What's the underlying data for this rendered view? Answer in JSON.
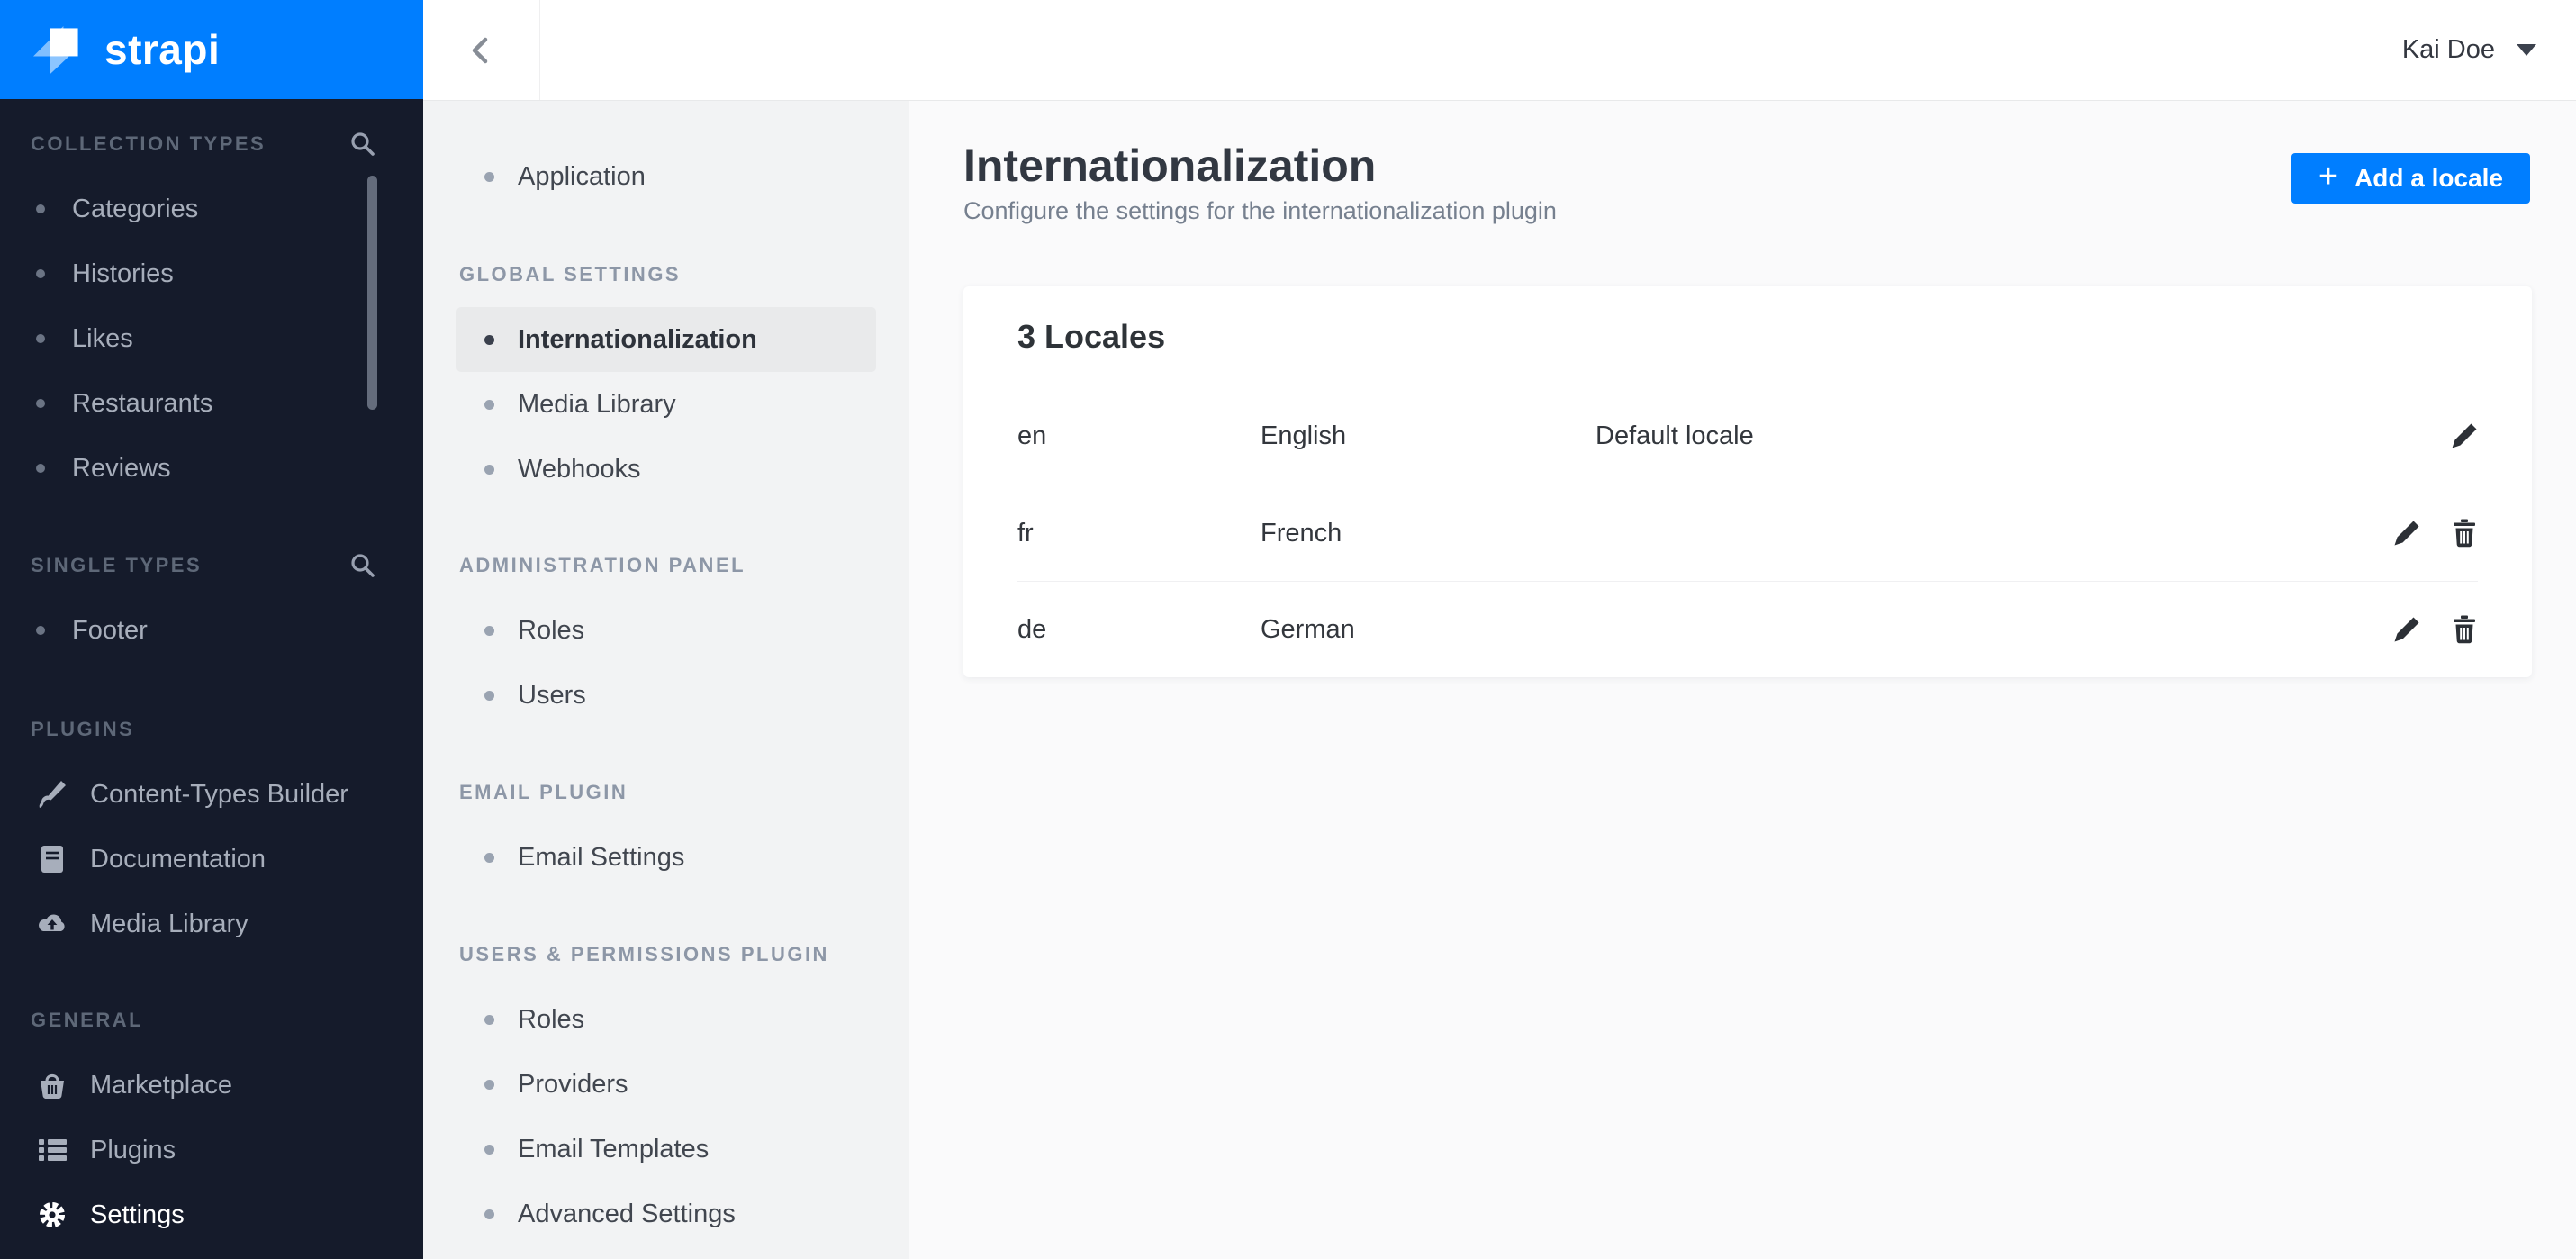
{
  "colors": {
    "accent": "#007eff",
    "sidebar_bg": "#151b2b",
    "selected_item_bg": "#e9eaeb",
    "content_bg": "#fafafb",
    "secondary_nav_bg": "#f2f3f4"
  },
  "logo": {
    "text": "strapi"
  },
  "topbar": {
    "user_name": "Kai Doe"
  },
  "icons": {
    "search": "magnifier",
    "content_types_builder": "paintbrush",
    "documentation": "book",
    "media_library": "cloud-upload",
    "marketplace": "basket",
    "plugins": "list",
    "settings": "gear",
    "back": "chevron-left",
    "user_caret": "caret-down",
    "add": "plus",
    "edit": "pencil",
    "delete": "trash"
  },
  "sidebar": {
    "sections": [
      {
        "label": "COLLECTION TYPES",
        "has_search": true,
        "items": [
          {
            "label": "Categories"
          },
          {
            "label": "Histories"
          },
          {
            "label": "Likes"
          },
          {
            "label": "Restaurants"
          },
          {
            "label": "Reviews"
          }
        ]
      },
      {
        "label": "SINGLE TYPES",
        "has_search": true,
        "items": [
          {
            "label": "Footer"
          }
        ]
      },
      {
        "label": "PLUGINS",
        "has_search": false,
        "items": [
          {
            "label": "Content-Types Builder"
          },
          {
            "label": "Documentation"
          },
          {
            "label": "Media Library"
          }
        ]
      },
      {
        "label": "GENERAL",
        "has_search": false,
        "items": [
          {
            "label": "Marketplace"
          },
          {
            "label": "Plugins"
          },
          {
            "label": "Settings",
            "active": true
          }
        ]
      }
    ]
  },
  "settings_nav": {
    "top_items": [
      {
        "label": "Application"
      }
    ],
    "sections": [
      {
        "label": "GLOBAL SETTINGS",
        "items": [
          {
            "label": "Internationalization",
            "active": true
          },
          {
            "label": "Media Library"
          },
          {
            "label": "Webhooks"
          }
        ]
      },
      {
        "label": "ADMINISTRATION PANEL",
        "items": [
          {
            "label": "Roles"
          },
          {
            "label": "Users"
          }
        ]
      },
      {
        "label": "EMAIL PLUGIN",
        "items": [
          {
            "label": "Email Settings"
          }
        ]
      },
      {
        "label": "USERS & PERMISSIONS PLUGIN",
        "items": [
          {
            "label": "Roles"
          },
          {
            "label": "Providers"
          },
          {
            "label": "Email Templates"
          },
          {
            "label": "Advanced Settings"
          }
        ]
      }
    ]
  },
  "page": {
    "title": "Internationalization",
    "subtitle": "Configure the settings for the internationalization plugin",
    "add_button": {
      "plus": "+",
      "label": "Add a locale"
    }
  },
  "locales_card": {
    "heading": "3 Locales",
    "rows": [
      {
        "code": "en",
        "name": "English",
        "note": "Default locale",
        "deletable": false
      },
      {
        "code": "fr",
        "name": "French",
        "note": "",
        "deletable": true
      },
      {
        "code": "de",
        "name": "German",
        "note": "",
        "deletable": true
      }
    ]
  }
}
